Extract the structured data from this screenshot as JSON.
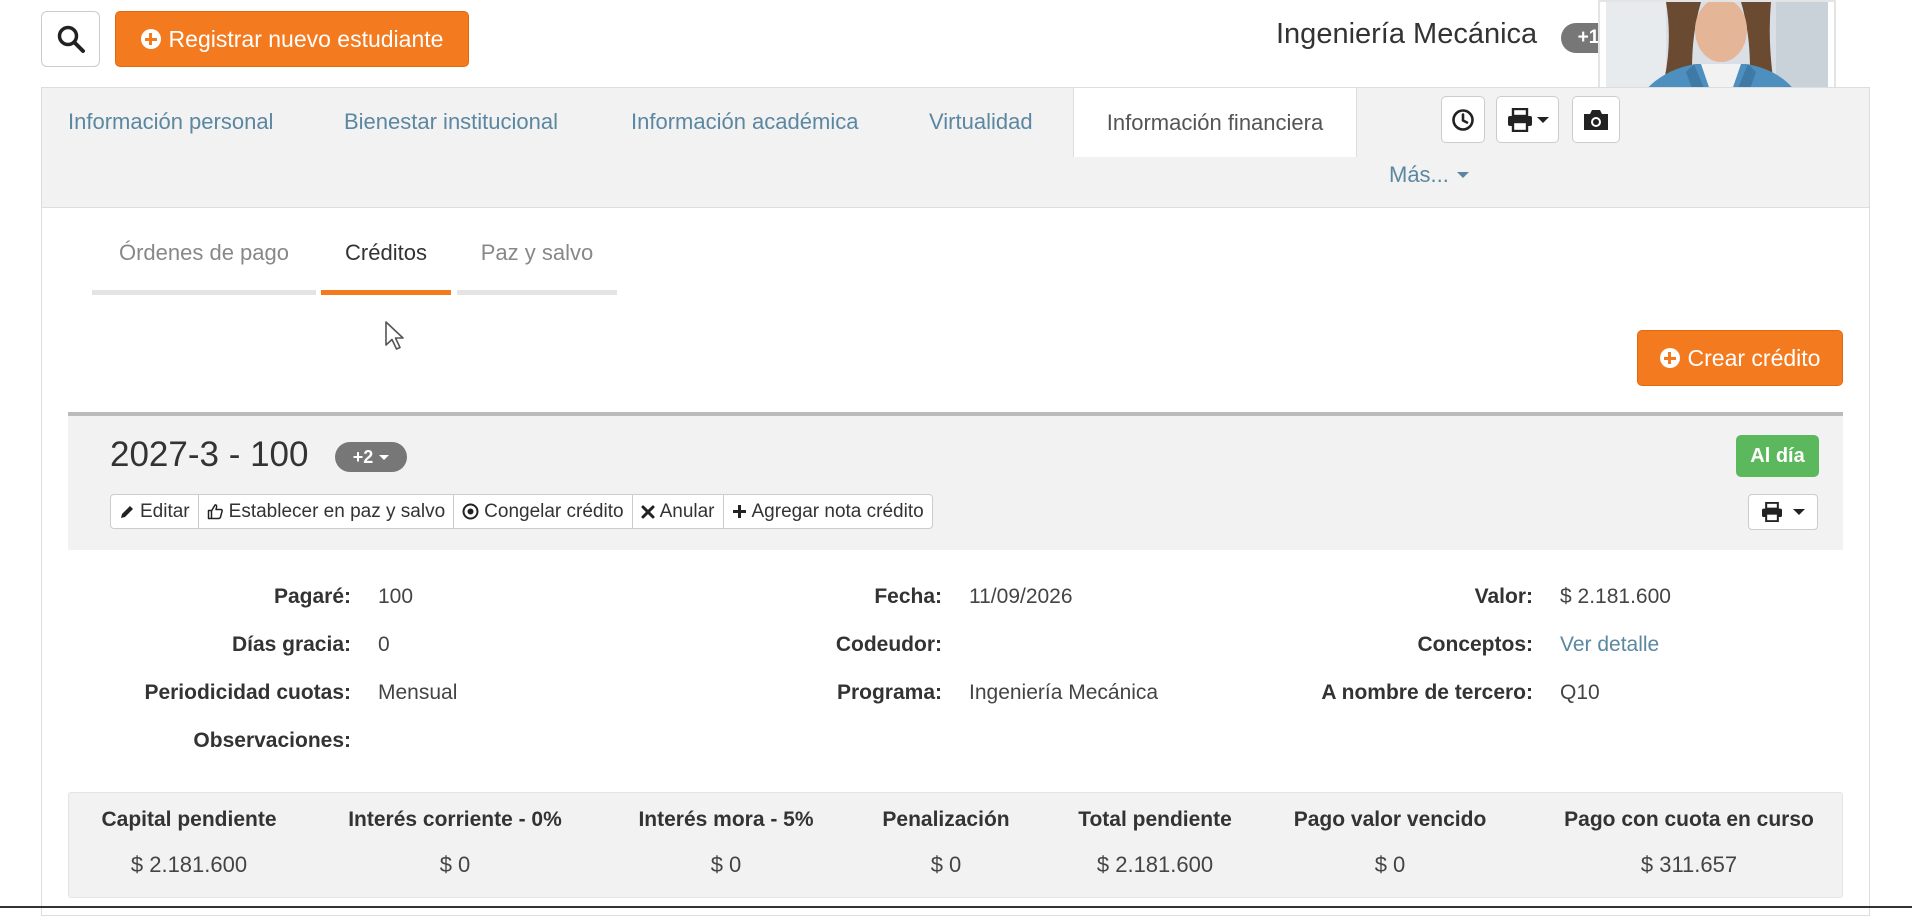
{
  "header": {
    "register_label": "Registrar nuevo estudiante",
    "program_name": "Ingeniería Mecánica",
    "program_badge": "+1"
  },
  "main_tabs": [
    {
      "label": "Información personal"
    },
    {
      "label": "Bienestar institucional"
    },
    {
      "label": "Información académica"
    },
    {
      "label": "Virtualidad"
    },
    {
      "label": "Información financiera",
      "active": true
    }
  ],
  "more_label": "Más...",
  "sub_tabs": [
    {
      "label": "Órdenes de pago"
    },
    {
      "label": "Créditos",
      "active": true
    },
    {
      "label": "Paz y salvo"
    }
  ],
  "create_credit_label": "Crear crédito",
  "credit": {
    "title": "2027-3 - 100",
    "badge": "+2",
    "status": "Al día",
    "actions": [
      {
        "label": "Editar",
        "icon": "pencil-icon"
      },
      {
        "label": "Establecer en paz y salvo",
        "icon": "thumbs-up-icon"
      },
      {
        "label": "Congelar crédito",
        "icon": "dot-circle-icon"
      },
      {
        "label": "Anular",
        "icon": "x-icon"
      },
      {
        "label": "Agregar nota crédito",
        "icon": "plus-icon"
      }
    ],
    "fields": {
      "pagare": {
        "label": "Pagaré:",
        "value": "100"
      },
      "dias_gracia": {
        "label": "Días gracia:",
        "value": "0"
      },
      "periodicidad": {
        "label": "Periodicidad cuotas:",
        "value": "Mensual"
      },
      "observaciones": {
        "label": "Observaciones:",
        "value": ""
      },
      "fecha": {
        "label": "Fecha:",
        "value": "11/09/2026"
      },
      "codeudor": {
        "label": "Codeudor:",
        "value": ""
      },
      "programa": {
        "label": "Programa:",
        "value": "Ingeniería Mecánica"
      },
      "valor": {
        "label": "Valor:",
        "value": "$ 2.181.600"
      },
      "conceptos": {
        "label": "Conceptos:",
        "value": "Ver detalle"
      },
      "tercero": {
        "label": "A nombre de tercero:",
        "value": "Q10"
      }
    },
    "summary": [
      {
        "label": "Capital pendiente",
        "value": "$ 2.181.600"
      },
      {
        "label": "Interés corriente - 0%",
        "value": "$ 0"
      },
      {
        "label": "Interés mora - 5%",
        "value": "$ 0"
      },
      {
        "label": "Penalización",
        "value": "$ 0"
      },
      {
        "label": "Total pendiente",
        "value": "$ 2.181.600"
      },
      {
        "label": "Pago valor vencido",
        "value": "$ 0"
      },
      {
        "label": "Pago con cuota en curso",
        "value": "$ 311.657"
      }
    ]
  },
  "colors": {
    "accent": "#f47a1f",
    "link": "#5b87a1",
    "success": "#5cb85c",
    "badge": "#777777"
  }
}
